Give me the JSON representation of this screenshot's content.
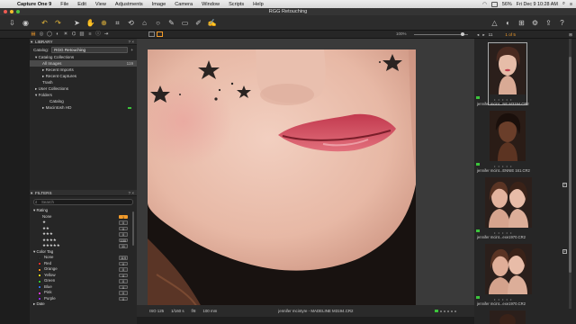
{
  "menubar": {
    "apple": "",
    "items": [
      "Capture One 9",
      "File",
      "Edit",
      "View",
      "Adjustments",
      "Image",
      "Camera",
      "Window",
      "Scripts",
      "Help"
    ],
    "battery": "56%",
    "clock": "Fri Dec 9  10:28 AM"
  },
  "window": {
    "title": "RGG Retouching"
  },
  "toolbar": {
    "tools": [
      "import-icon",
      "capture-icon",
      "undo-icon",
      "redo-icon",
      "cursor-icon",
      "pan-icon",
      "zoom-icon",
      "crop-icon",
      "rotate-icon",
      "keystone-icon",
      "spot-icon",
      "brush-icon",
      "eraser-icon",
      "picker-icon",
      "annotate-icon",
      "warning-icon",
      "compare-icon",
      "grid-icon",
      "settings-icon",
      "share-icon",
      "help-icon"
    ]
  },
  "subbar": {
    "zoom": "100%",
    "browser_count": "1 of 5",
    "browser_label": "11"
  },
  "library": {
    "title": "LIBRARY",
    "catalog_label": "Catalog:",
    "catalog_value": "RGG Retouching",
    "catalog_collections": "Catalog Collections",
    "all_images": "All Images",
    "all_images_count": "119",
    "recent_imports": "Recent Imports",
    "recent_captures": "Recent Captures",
    "trash": "Trash",
    "user_collections": "User Collections",
    "folders": "Folders",
    "catalog": "Catalog",
    "macintosh_hd": "Macintosh HD"
  },
  "filters": {
    "title": "FILTERS",
    "search_placeholder": "Search",
    "rating_head": "Rating",
    "ratings": [
      {
        "label": "None",
        "count": "1"
      },
      {
        "label": "★",
        "count": "0"
      },
      {
        "label": "★★",
        "count": "0"
      },
      {
        "label": "★★★",
        "count": "0"
      },
      {
        "label": "★★★★",
        "count": "100"
      },
      {
        "label": "★★★★★",
        "count": "11"
      }
    ],
    "color_head": "Color Tag",
    "colors": [
      {
        "label": "None",
        "count": "119",
        "color": "#2a2a2a"
      },
      {
        "label": "Red",
        "count": "0",
        "color": "#e0302a"
      },
      {
        "label": "Orange",
        "count": "0",
        "color": "#f08a1c"
      },
      {
        "label": "Yellow",
        "count": "0",
        "color": "#e6d41c"
      },
      {
        "label": "Green",
        "count": "0",
        "color": "#34c234"
      },
      {
        "label": "Blue",
        "count": "0",
        "color": "#2d6de0"
      },
      {
        "label": "Pink",
        "count": "0",
        "color": "#e23ad0"
      },
      {
        "label": "Purple",
        "count": "0",
        "color": "#8a2be2"
      }
    ],
    "date_head": "Date"
  },
  "viewer": {
    "iso": "ISO 125",
    "shutter": "1/160 s",
    "aperture": "f/8",
    "focal": "100 mm",
    "filename": "jennifer mcintyre - MADELINE M3194.CR2"
  },
  "browser": {
    "thumbs": [
      {
        "caption": "jennifer mcint...NE M3194.CR2",
        "stars": "• • • • •"
      },
      {
        "caption": "jennifer mcint...ENNIE 161.CR2",
        "stars": "• • • • •"
      },
      {
        "caption": "jennifer mcint...exe1970.CR2",
        "stars": "• • • • •"
      },
      {
        "caption": "jennifer mcint...exe1970.CR2",
        "stars": "• • • • •"
      }
    ],
    "badge_1": "2",
    "badge_2": "2"
  },
  "colors": {
    "accent": "#f39c2b",
    "green": "#3cc43c"
  }
}
